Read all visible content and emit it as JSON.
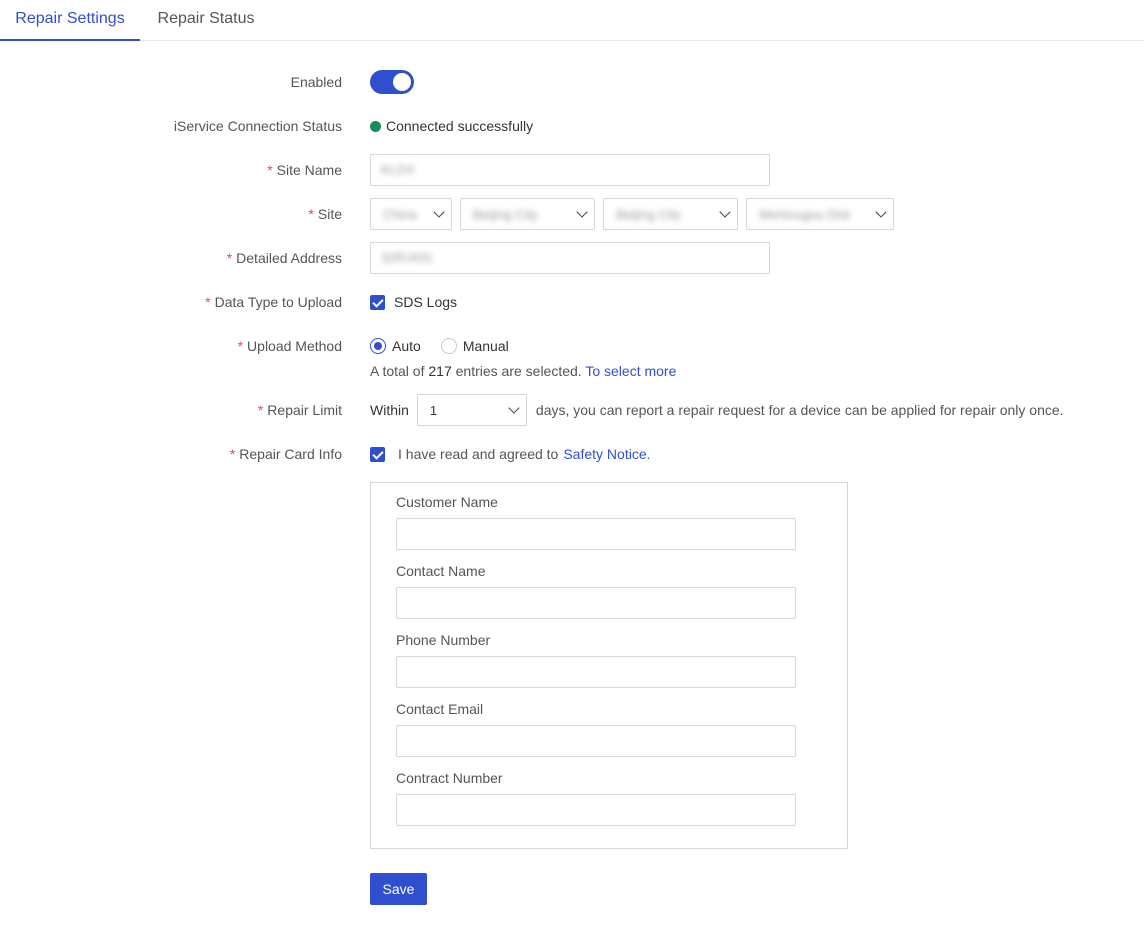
{
  "tabs": [
    {
      "label": "Repair Settings",
      "active": true
    },
    {
      "label": "Repair Status",
      "active": false
    }
  ],
  "form": {
    "enabled_label": "Enabled",
    "enabled": true,
    "connection_label": "iService Connection Status",
    "connection_status": "Connected successfully",
    "connection_color": "#1a8a5a",
    "site_name_label": "Site Name",
    "site_name_value": "KLDX",
    "site_label": "Site",
    "site_country": "China",
    "site_province": "Beijing City",
    "site_city": "Beijing City",
    "site_district": "Mentougou Dist",
    "address_label": "Detailed Address",
    "address_value": "32RJ431",
    "data_type_label": "Data Type to Upload",
    "data_type_option": "SDS Logs",
    "upload_method_label": "Upload Method",
    "upload_auto": "Auto",
    "upload_manual": "Manual",
    "selected_method": "Auto",
    "hint_prefix": "A total of",
    "hint_count": "217",
    "hint_suffix": "entries are selected.",
    "hint_link": "To select more",
    "repair_limit_label": "Repair Limit",
    "within_label": "Within",
    "repair_limit_value": "1",
    "repair_limit_suffix": "days, you can report a repair request for a device can be applied for repair only once.",
    "repair_card_label": "Repair Card Info",
    "agree_text": "I have read and agreed to",
    "safety_link": "Safety Notice."
  },
  "card": {
    "customer_name": "Customer Name",
    "contact_name": "Contact Name",
    "phone_number": "Phone Number",
    "contact_email": "Contact Email",
    "contract_number": "Contract Number"
  },
  "save_label": "Save",
  "accent_color": "#2f4fcf"
}
